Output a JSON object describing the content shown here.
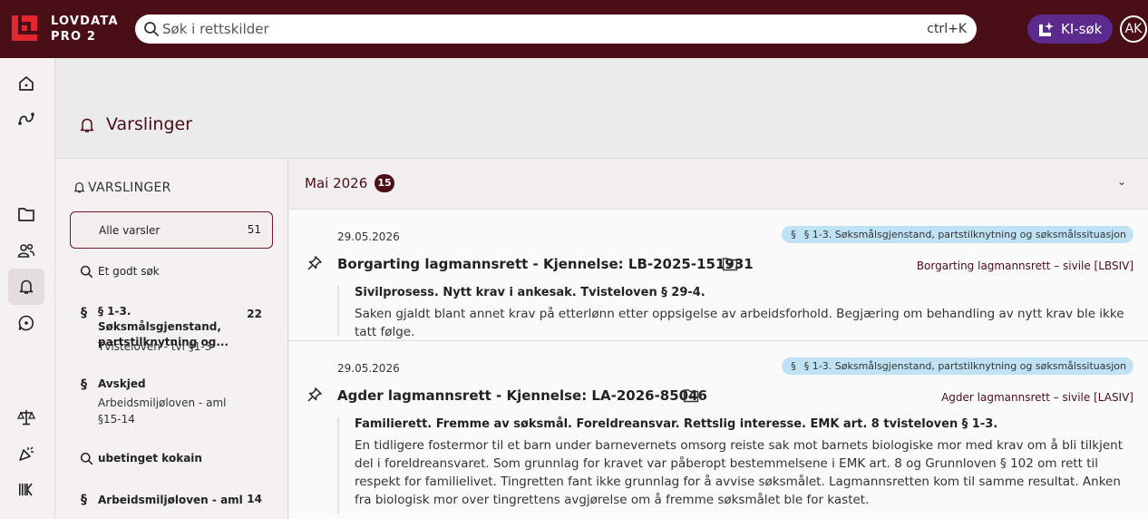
{
  "header": {
    "brand_line1": "LOVDATA",
    "brand_line2": "PRO 2",
    "search_placeholder": "Søk i rettskilder",
    "search_shortcut": "ctrl+K",
    "ki_button_label": "KI-søk",
    "avatar_initials": "AK"
  },
  "rail": {
    "icons": [
      "home-icon",
      "route-icon",
      "folder-icon",
      "users-icon",
      "bell-icon",
      "chat-icon",
      "scales-icon",
      "party-icon",
      "barcode-icon"
    ],
    "active": "bell-icon"
  },
  "page": {
    "title": "Varslinger"
  },
  "sidebar": {
    "heading": "VARSLINGER",
    "items": [
      {
        "label": "Alle varsler",
        "count": "51",
        "icon": "none",
        "sub": ""
      },
      {
        "label": "Et godt søk",
        "count": "",
        "icon": "search-icon",
        "sub": ""
      },
      {
        "label": "§ 1-3. Søksmålsgjenstand, partstilknytning og...",
        "count": "22",
        "icon": "§",
        "sub": "Tvisteloven - tvl §1-3"
      },
      {
        "label": "Avskjed",
        "count": "",
        "icon": "§",
        "sub": "Arbeidsmiljøloven - aml §15-14"
      },
      {
        "label": "ubetinget kokain",
        "count": "",
        "icon": "search-icon",
        "sub": ""
      },
      {
        "label": "Arbeidsmiljøloven - aml",
        "count": "14",
        "icon": "§",
        "sub": ""
      }
    ]
  },
  "main": {
    "month_label": "Mai 2026",
    "month_count": "15",
    "cards": [
      {
        "date": "29.05.2026",
        "tag_symbol": "§",
        "tag": "§ 1-3. Søksmålsgjenstand, partstilknytning og søksmålssituasjon",
        "title": "Borgarting lagmannsrett - Kjennelse: LB-2025-151931",
        "court": "Borgarting lagmannsrett – sivile [LBSIV]",
        "summary_heading": "Sivilprosess. Nytt krav i ankesak. Tvisteloven § 29-4.",
        "summary_body": "Saken gjaldt blant annet krav på etterlønn etter oppsigelse av arbeidsforhold. Begjæring om behandling av nytt krav ble ikke tatt følge."
      },
      {
        "date": "29.05.2026",
        "tag_symbol": "§",
        "tag": "§ 1-3. Søksmålsgjenstand, partstilknytning og søksmålssituasjon",
        "title": "Agder lagmannsrett - Kjennelse: LA-2026-85046",
        "court": "Agder lagmannsrett – sivile [LASIV]",
        "summary_heading": "Familierett. Fremme av søksmål. Foreldreansvar. Rettslig interesse. EMK art. 8 tvisteloven § 1-3.",
        "summary_body": "En tidligere fostermor til et barn under barnevernets omsorg reiste sak mot barnets biologiske mor med krav om å bli tilkjent del i foreldreansvaret. Som grunnlag for kravet var påberopt bestemmelsene i EMK art. 8 og Grunnloven § 102 om rett til respekt for familielivet. Tingretten fant ikke grunnlag for å avvise søksmålet. Lagmannsretten kom til samme resultat. Anken fra biologisk mor over tingrettens avgjørelse om å fremme søksmålet ble for kastet."
      }
    ]
  },
  "colors": {
    "brand": "#4a0e17",
    "ki_button": "#5a2a8c",
    "tag_bg": "#bfe2f5",
    "logo_red": "#e3262f"
  }
}
